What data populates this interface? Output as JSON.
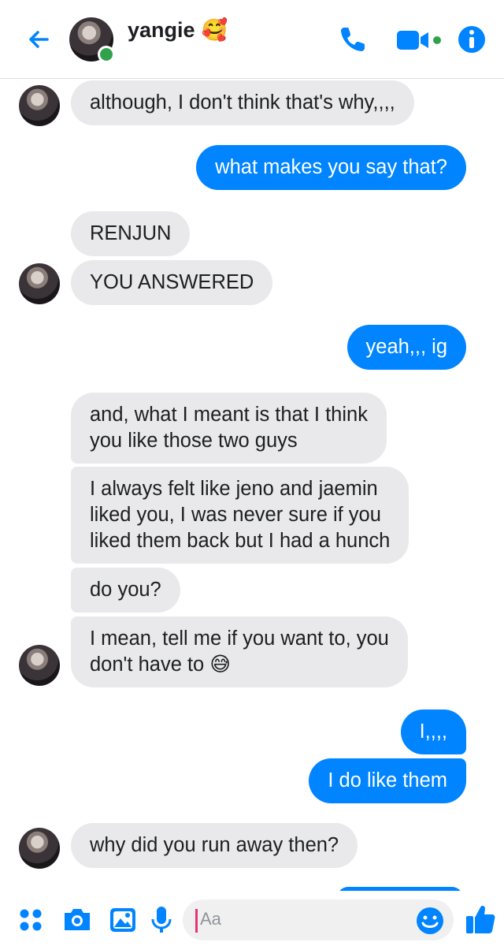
{
  "header": {
    "contact_name": "yangie",
    "name_emoji": "🥰",
    "status": "online"
  },
  "colors": {
    "accent": "#0084ff",
    "incoming_bubble": "#e9e9eb",
    "online": "#31a24c"
  },
  "messages": [
    {
      "side": "in",
      "text": "although, I don't think that's why,,,,"
    },
    {
      "side": "out",
      "text": "what makes you say that?"
    },
    {
      "side": "in",
      "text": "RENJUN"
    },
    {
      "side": "in",
      "text": "YOU ANSWERED"
    },
    {
      "side": "out",
      "text": "yeah,,, ig"
    },
    {
      "side": "in",
      "text": "and, what I meant is that I think\nyou like those two guys"
    },
    {
      "side": "in",
      "text": "I always felt like jeno and jaemin\nliked you, I was never sure if you\nliked them back but I had a hunch"
    },
    {
      "side": "in",
      "text": "do you?"
    },
    {
      "side": "in",
      "text": "I mean, tell me if you want to, you\ndon't have to 😅"
    },
    {
      "side": "out",
      "text": "I,,,,"
    },
    {
      "side": "out",
      "text": "I do like them"
    },
    {
      "side": "in",
      "text": "why did you run away then?"
    }
  ],
  "composer": {
    "placeholder": "Aa"
  },
  "icons": {
    "back": "back-arrow-icon",
    "call": "phone-icon",
    "video": "video-call-icon",
    "info": "info-icon",
    "more": "more-apps-icon",
    "camera": "camera-icon",
    "gallery": "image-icon",
    "voice": "microphone-icon",
    "emoji": "emoji-icon",
    "like": "thumbs-up-icon"
  }
}
